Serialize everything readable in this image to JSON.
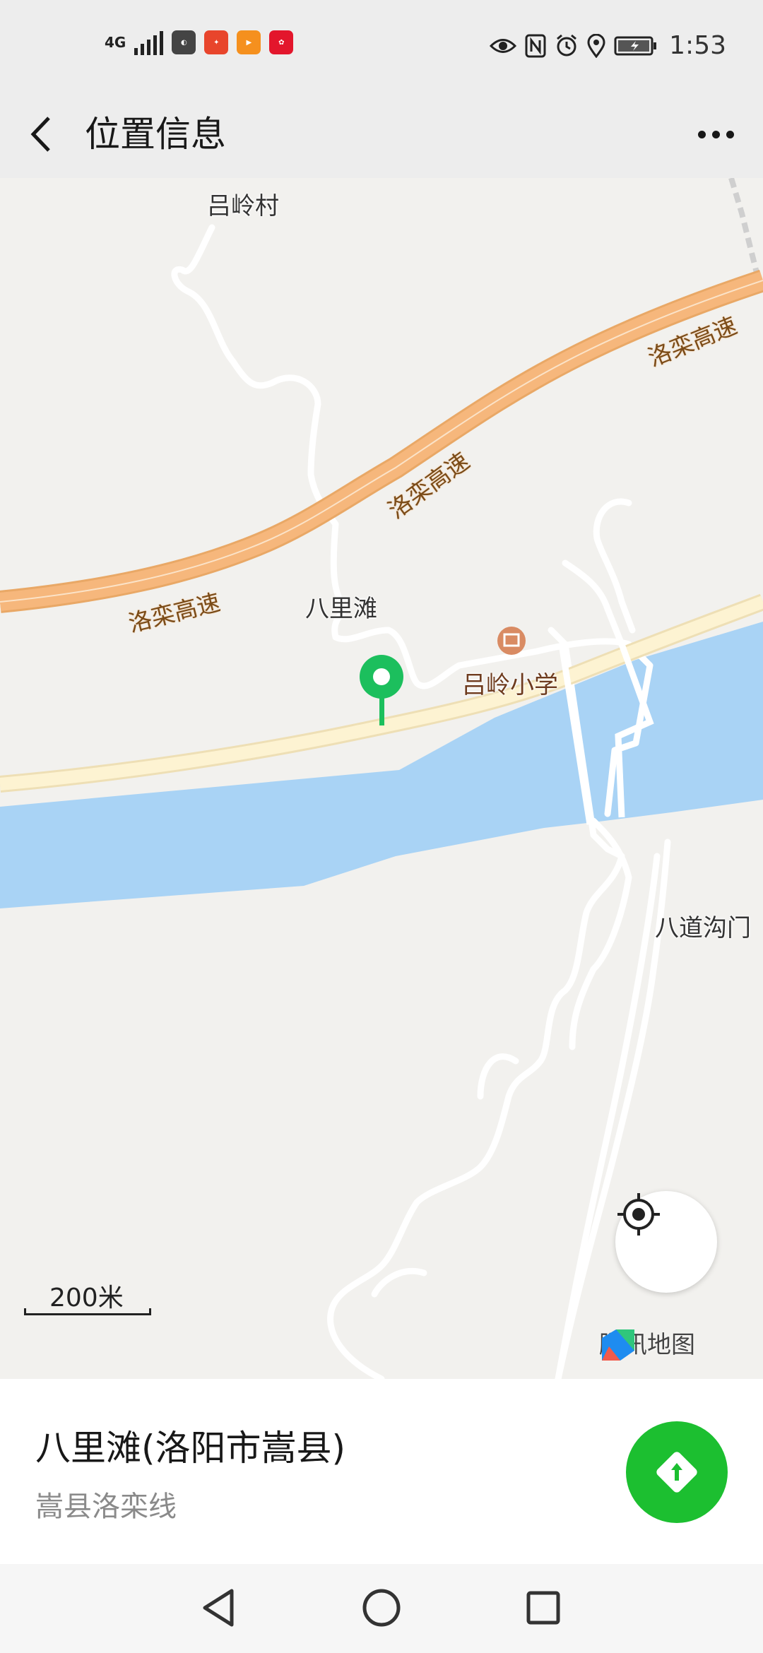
{
  "status_bar": {
    "network": "4G",
    "time": "1:53",
    "app_icons": [
      "huawei-app-icon",
      "tejia-app-icon",
      "video-app-icon",
      "gift-app-icon"
    ],
    "indicators": [
      "eye-icon",
      "nfc-icon",
      "alarm-icon",
      "location-icon",
      "battery-charging-icon"
    ]
  },
  "header": {
    "title": "位置信息",
    "back_icon": "chevron-left-icon",
    "more_icon": "more-dots-icon"
  },
  "map": {
    "labels": {
      "village_top": "吕岭村",
      "highway_1": "洛栾高速",
      "highway_2": "洛栾高速",
      "highway_3": "洛栾高速",
      "place_balitan": "八里滩",
      "school": "吕岭小学",
      "badaogoumen": "八道沟门"
    },
    "scale": "200米",
    "provider": "腾讯地图",
    "colors": {
      "land": "#f2f1ee",
      "river": "#a9d3f5",
      "highway": "#f6b77c",
      "road_main": "#fdf3d2",
      "marker": "#1cbf5d"
    }
  },
  "place": {
    "name": "八里滩(洛阳市嵩县)",
    "address": "嵩县洛栾线"
  },
  "nav_bar": {
    "icons": [
      "back-triangle-icon",
      "home-circle-icon",
      "recent-square-icon"
    ]
  }
}
